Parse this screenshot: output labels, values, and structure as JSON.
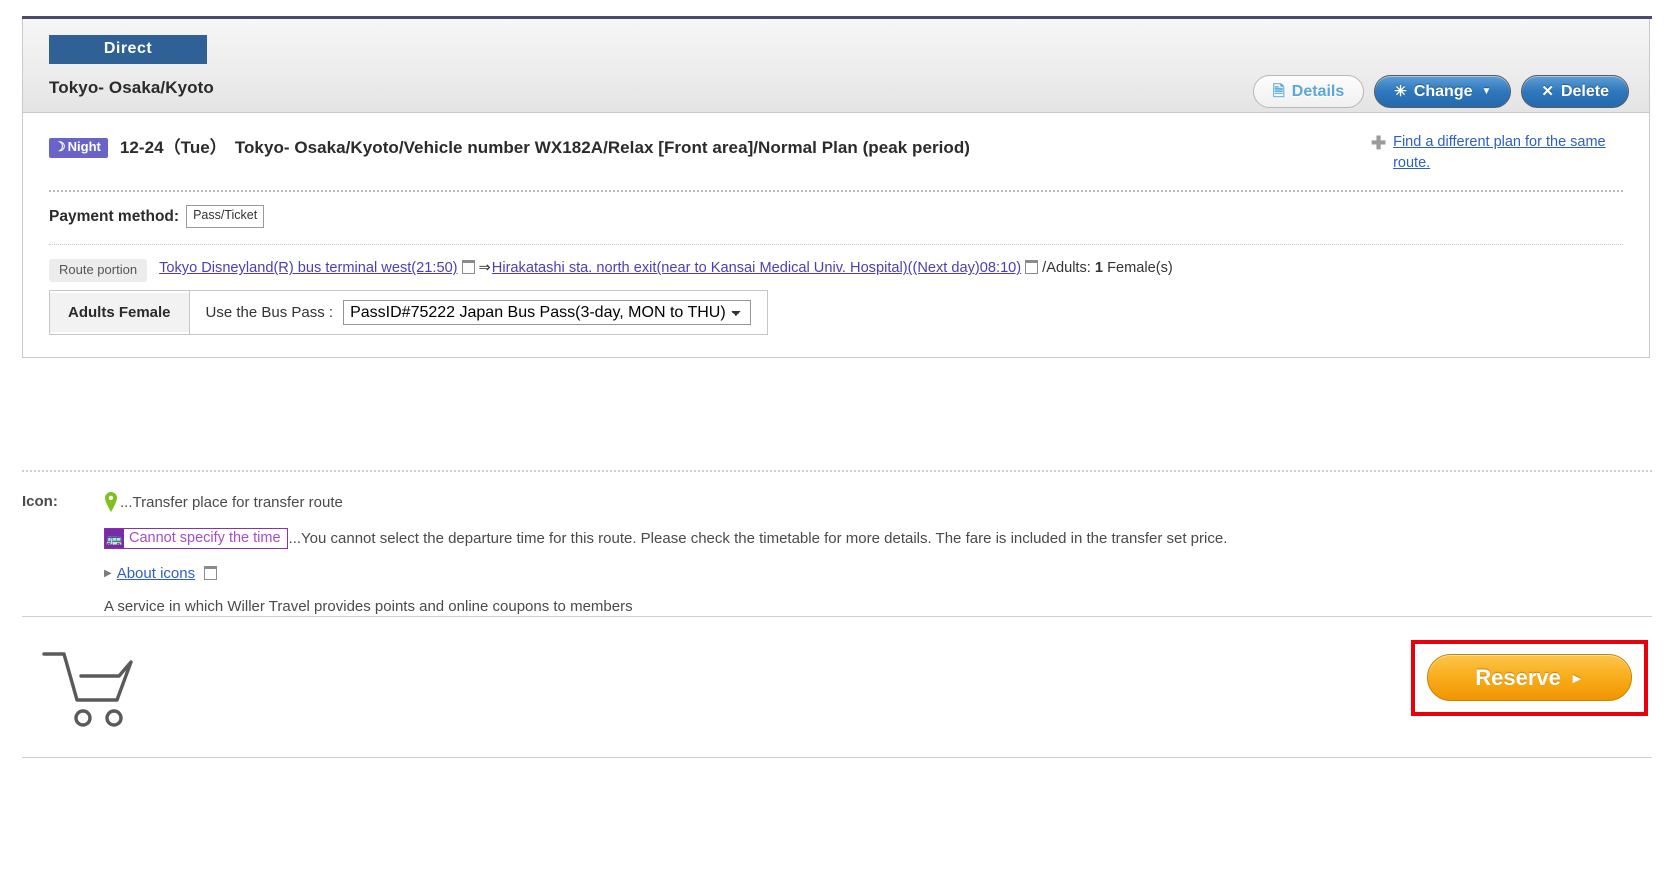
{
  "header": {
    "badge": "Direct",
    "route_title": "Tokyo- Osaka/Kyoto",
    "buttons": {
      "details": "Details",
      "change": "Change",
      "delete": "Delete"
    }
  },
  "trip": {
    "night_badge": "Night",
    "date": "12-24（Tue）",
    "description": "Tokyo- Osaka/Kyoto/Vehicle number WX182A/Relax [Front area]/Normal Plan (peak period)",
    "find_plan_link": "Find a different plan for the same route."
  },
  "payment": {
    "label": "Payment method:",
    "value": "Pass/Ticket"
  },
  "route": {
    "tag": "Route portion",
    "departure": "Tokyo Disneyland(R) bus terminal west(21:50)",
    "arrow": "⇒",
    "arrival": "Hirakatashi sta. north exit(near to Kansai Medical Univ. Hospital)((Next day)08:10)",
    "passengers_prefix": "/Adults: ",
    "passengers_count": "1",
    "passengers_suffix": " Female(s)"
  },
  "pass": {
    "row_header": "Adults Female",
    "label": "Use the Bus Pass :",
    "selected": "PassID#75222 Japan Bus Pass(3-day, MON to THU)",
    "options": [
      "PassID#75222 Japan Bus Pass(3-day, MON to THU)"
    ]
  },
  "legend": {
    "key": "Icon:",
    "pin_text": "...Transfer place for transfer route",
    "chip_label": "Cannot specify the time",
    "chip_text": "...You cannot select the departure time for this route. Please check the timetable for more details. The fare is included in the transfer set price.",
    "about_icons": "About icons",
    "note": "A service in which Willer Travel provides points and online coupons to members"
  },
  "footer": {
    "reserve_label": "Reserve",
    "reserve_caret": "►"
  },
  "colors": {
    "direct_badge": "#2f6196",
    "night_badge": "#6a63c8",
    "link": "#4b3fb5",
    "reserve": "#f9ae1b",
    "highlight": "#e8000b"
  }
}
